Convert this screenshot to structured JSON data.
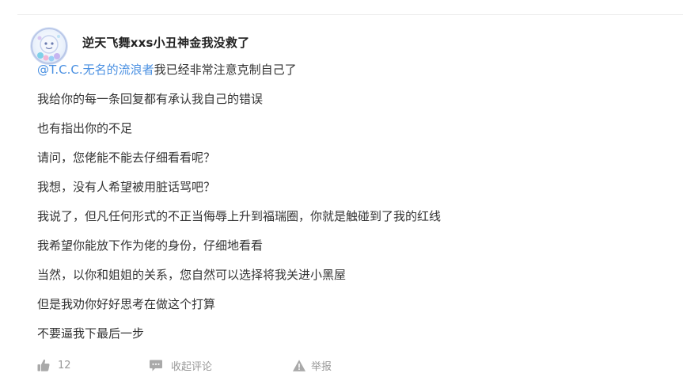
{
  "post": {
    "username": "逆天飞舞xxs小丑神金我没救了",
    "mention": "@T.C.C.无名的流浪者",
    "first_line_rest": "我已经非常注意克制自己了",
    "lines": [
      "我给你的每一条回复都有承认我自己的错误",
      "也有指出你的不足",
      "请问，您佬能不能去仔细看看呢？",
      "我想，没有人希望被用脏话骂吧？",
      "我说了，但凡任何形式的不正当侮辱上升到福瑞圈，你就是触碰到了我的红线",
      "我希望你能放下作为佬的身份，仔细地看看",
      "当然，以你和姐姐的关系，您自然可以选择将我关进小黑屋",
      "但是我劝你好好思考在做这个打算",
      "不要逼我下最后一步"
    ]
  },
  "actions": {
    "like_count": "12",
    "like_icon": "thumbs-up-icon",
    "collapse_comments_label": "收起评论",
    "comment_icon": "comment-bubble-icon",
    "report_label": "举报",
    "report_icon": "warning-triangle-icon"
  },
  "colors": {
    "mention": "#4a90e2",
    "text": "#333333",
    "muted": "#999999"
  }
}
